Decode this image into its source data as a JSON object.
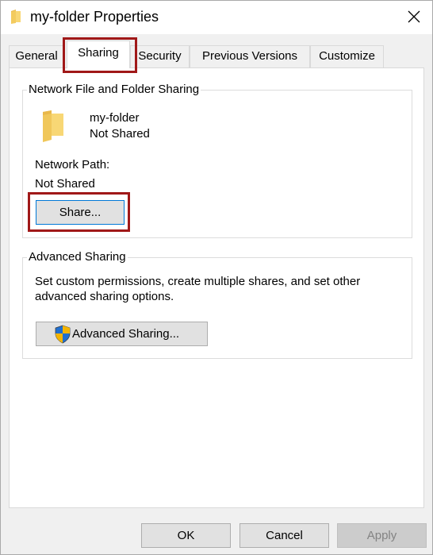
{
  "window": {
    "title": "my-folder Properties",
    "close_icon": "close-icon"
  },
  "tabs": [
    {
      "label": "General",
      "active": false
    },
    {
      "label": "Sharing",
      "active": true
    },
    {
      "label": "Security",
      "active": false
    },
    {
      "label": "Previous Versions",
      "active": false
    },
    {
      "label": "Customize",
      "active": false
    }
  ],
  "network_sharing": {
    "group_label": "Network File and Folder Sharing",
    "folder_icon": "folder-icon",
    "folder_name": "my-folder",
    "share_status": "Not Shared",
    "network_path_label": "Network Path:",
    "network_path_value": "Not Shared",
    "share_button": "Share..."
  },
  "advanced_sharing": {
    "group_label": "Advanced Sharing",
    "description_line1": "Set custom permissions, create multiple shares, and set other",
    "description_line2": "advanced sharing options.",
    "shield_icon": "uac-shield-icon",
    "button_label": "Advanced Sharing..."
  },
  "footer": {
    "ok_label": "OK",
    "cancel_label": "Cancel",
    "apply_label": "Apply"
  },
  "colors": {
    "highlight": "#a01818",
    "focus_border": "#0078d7",
    "folder_yellow": "#f8d775"
  }
}
